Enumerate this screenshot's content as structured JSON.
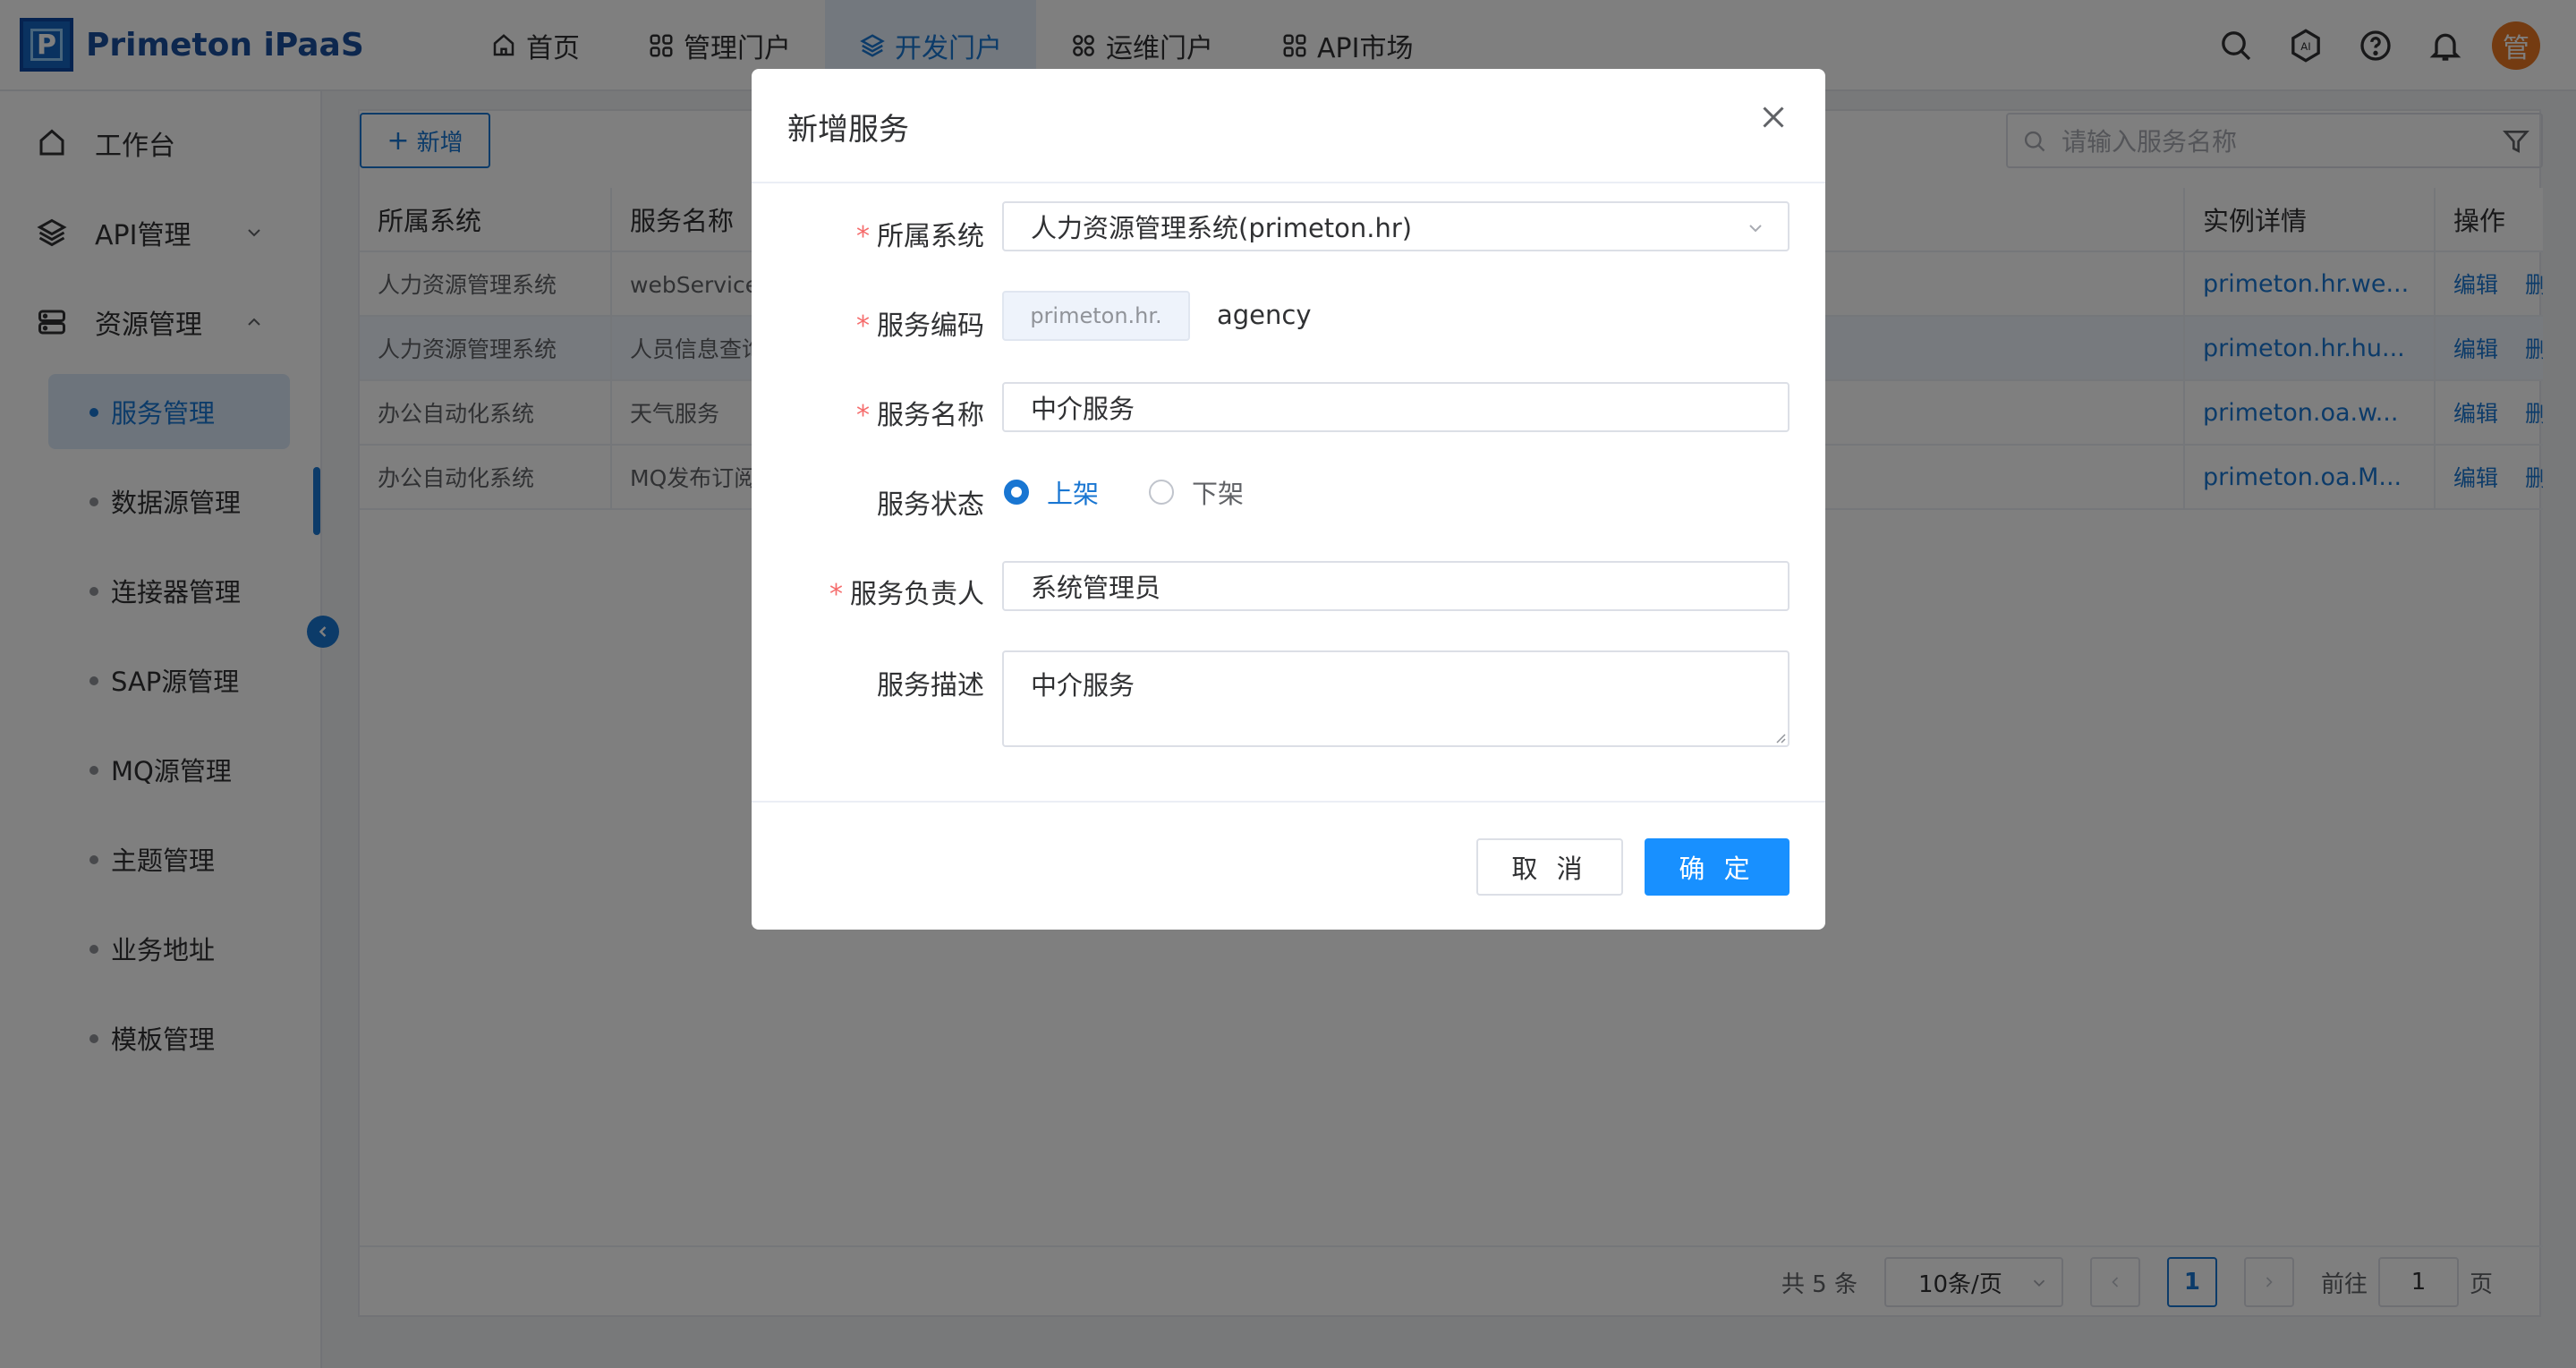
{
  "header": {
    "logo_text": "Primeton iPaaS",
    "nav": [
      {
        "label": "首页",
        "icon": "home-icon"
      },
      {
        "label": "管理门户",
        "icon": "grid-icon"
      },
      {
        "label": "开发门户",
        "icon": "layers-icon",
        "active": true
      },
      {
        "label": "运维门户",
        "icon": "grid-icon"
      },
      {
        "label": "API市场",
        "icon": "grid-icon"
      }
    ],
    "avatar_text": "管",
    "ai_label": "AI"
  },
  "sidebar": {
    "workbench": "工作台",
    "api_mgmt": "API管理",
    "resource_mgmt": "资源管理",
    "sub_items": [
      "服务管理",
      "数据源管理",
      "连接器管理",
      "SAP源管理",
      "MQ源管理",
      "主题管理",
      "业务地址",
      "模板管理"
    ]
  },
  "toolbar": {
    "add_label": "新增",
    "search_placeholder": "请输入服务名称"
  },
  "table": {
    "columns": [
      "所属系统",
      "服务名称",
      "",
      "实例详情",
      "操作"
    ],
    "rows": [
      {
        "system": "人力资源管理系统",
        "name": "webService服",
        "instance": "primeton.hr.we...",
        "edit": "编辑",
        "delete": "删除"
      },
      {
        "system": "人力资源管理系统",
        "name": "人员信息查询",
        "instance": "primeton.hr.hu...",
        "edit": "编辑",
        "delete": "删除"
      },
      {
        "system": "办公自动化系统",
        "name": "天气服务",
        "instance": "primeton.oa.w...",
        "edit": "编辑",
        "delete": "删除"
      },
      {
        "system": "办公自动化系统",
        "name": "MQ发布订阅",
        "instance": "primeton.oa.M...",
        "edit": "编辑",
        "delete": "删除"
      }
    ]
  },
  "pagination": {
    "total": "共 5 条",
    "page_size": "10条/页",
    "current": "1",
    "goto_label": "前往",
    "goto_value": "1",
    "page_unit": "页"
  },
  "dialog": {
    "title": "新增服务",
    "system_label": "所属系统",
    "system_value": "人力资源管理系统(primeton.hr)",
    "code_label": "服务编码",
    "code_prefix": "primeton.hr.",
    "code_value": "agency",
    "name_label": "服务名称",
    "name_value": "中介服务",
    "status_label": "服务状态",
    "status_on": "上架",
    "status_off": "下架",
    "owner_label": "服务负责人",
    "owner_value": "系统管理员",
    "desc_label": "服务描述",
    "desc_value": "中介服务",
    "cancel": "取 消",
    "ok": "确 定"
  },
  "colors": {
    "primary": "#1976d2",
    "button": "#1890ff",
    "avatar": "#e87722",
    "required": "#f56c6c"
  }
}
